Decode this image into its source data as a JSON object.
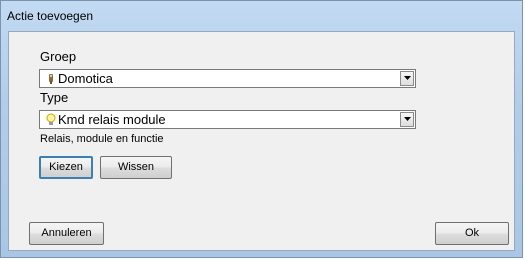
{
  "window": {
    "title": "Actie toevoegen"
  },
  "form": {
    "group_label": "Groep",
    "group_value": "Domotica",
    "group_icon": "domotica-device-icon",
    "type_label": "Type",
    "type_value": "Kmd relais module",
    "type_icon": "lightbulb-icon",
    "description": "Relais, module en functie"
  },
  "buttons": {
    "choose": "Kiezen",
    "clear": "Wissen",
    "cancel": "Annuleren",
    "ok": "Ok"
  },
  "colors": {
    "title_gradient_top": "#c2daf2",
    "title_gradient_bottom": "#a9c6e6",
    "client_bg": "#f0f0f0",
    "default_button_border": "#3c7fb1"
  }
}
